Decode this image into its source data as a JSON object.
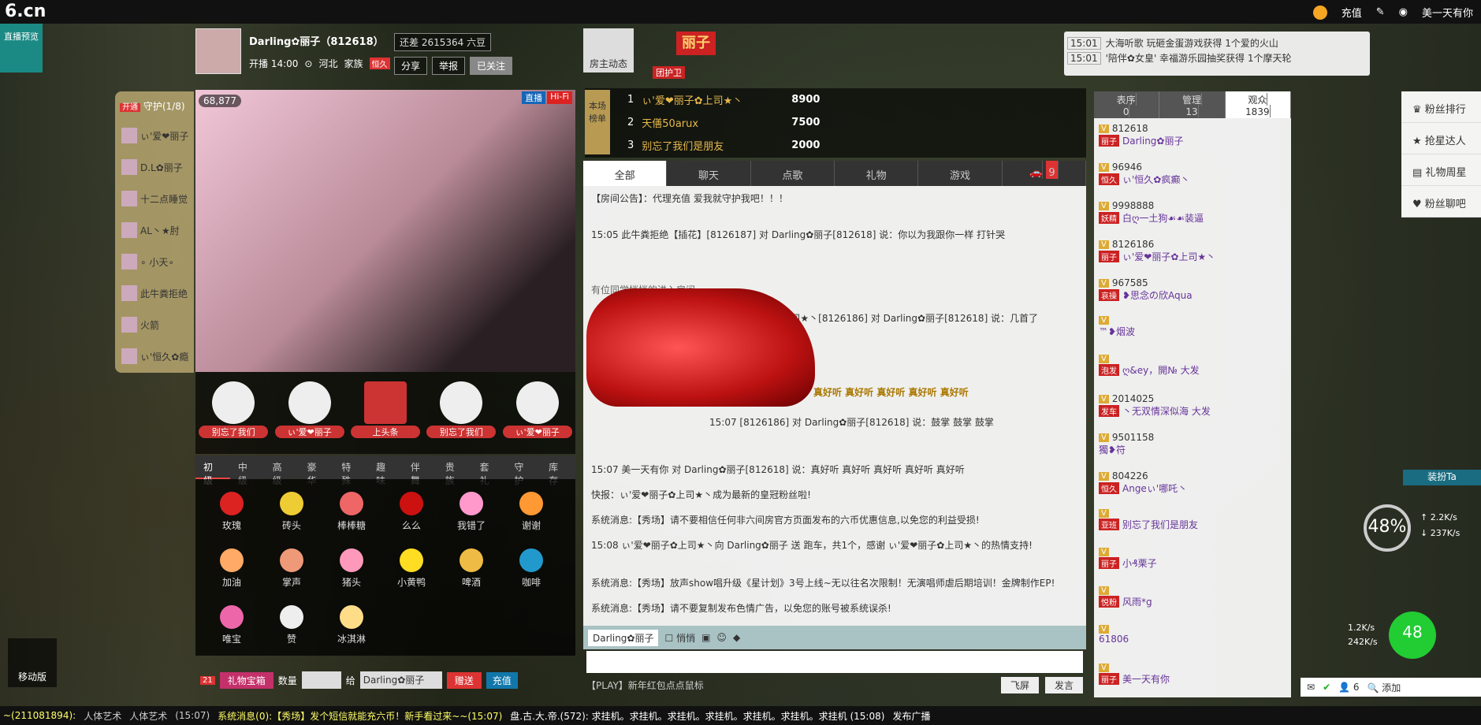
{
  "topbar": {
    "logo": "6.cn",
    "recharge": "充值",
    "username": "美一天有你"
  },
  "live_preview": "直播预览",
  "host": {
    "name": "Darling✿丽子（812618）",
    "start": "开播 14:00",
    "region": "河北",
    "family_label": "家族",
    "family": "恒久",
    "beans": "还差 2615364 六豆",
    "share": "分享",
    "report": "举报",
    "followed": "已关注"
  },
  "home_dynamic": "房主动态",
  "lizi_badge": "丽子",
  "guard_team": "团护卫",
  "notices": [
    {
      "time": "15:01",
      "text": "大海听歌 玩砸金蛋游戏获得 1个爱的火山"
    },
    {
      "time": "15:01",
      "text": "'陪伴✿女皇' 幸福游乐园抽奖获得 1个摩天轮"
    }
  ],
  "guards": {
    "open": "开通",
    "title": "守护(1/8)",
    "items": [
      "ぃ'爱❤丽子",
      "D.L✿丽子",
      "十二点睡觉",
      "AL丶★肘",
      "∘ 小天∘",
      "此牛粪拒绝",
      "火箭",
      "ぃ'恒久✿瘾"
    ]
  },
  "video": {
    "viewers": "68,877",
    "tag1": "直播",
    "tag2": "Hi-Fi"
  },
  "ads": [
    "别忘了我们",
    "ぃ'爱❤丽子",
    "上头条",
    "别忘了我们",
    "ぃ'爱❤丽子"
  ],
  "gift_tabs": [
    "初级",
    "中级",
    "高级",
    "豪华",
    "特殊",
    "趣味",
    "伴舞",
    "贵族",
    "套礼",
    "守护",
    "库存"
  ],
  "gifts": [
    "玫瑰",
    "砖头",
    "棒棒糖",
    "么么",
    "我错了",
    "谢谢",
    "加油",
    "掌声",
    "猪头",
    "小黄鸭",
    "啤酒",
    "咖啡",
    "唯宝",
    "赞",
    "冰淇淋"
  ],
  "send": {
    "chest": "礼物宝箱",
    "chest_count": "21",
    "qty_label": "数量",
    "give_label": "给",
    "target": "Darling✿丽子",
    "give_btn": "赠送",
    "recharge": "充值"
  },
  "rank": {
    "title": "本场榜单",
    "rows": [
      {
        "n": "1",
        "nm": "ぃ'爱❤丽子✿上司★丶",
        "v": "8900"
      },
      {
        "n": "2",
        "nm": "天僐50arux",
        "v": "7500"
      },
      {
        "n": "3",
        "nm": "别忘了我们是朋友",
        "v": "2000"
      }
    ]
  },
  "chat_tabs": [
    "全部",
    "聊天",
    "点歌",
    "礼物",
    "游戏",
    "9"
  ],
  "chat": [
    "【房间公告】：代理充值 爱我就守护我吧！！！",
    "15:05 此牛粪拒绝【插花】[8126187] 对 Darling✿丽子[812618] 说：你以为我跟你一样 打针哭",
    "有位同学悄悄的进入房间",
    "ぃ'爱❤丽子✿上司★丶[8126186] 对 Darling✿丽子[812618] 说：几首了",
    "：真好听 真好听 真好听 真好听 真好听",
    "15:07 [8126186] 对 Darling✿丽子[812618] 说：鼓掌 鼓掌 鼓掌",
    "15:07 美一天有你 对 Darling✿丽子[812618] 说：真好听 真好听 真好听 真好听 真好听",
    "快报：ぃ'爱❤丽子✿上司★丶成为最新的皇冠粉丝啦!",
    "系统消息:【秀场】请不要相信任何非六间房官方页面发布的六币优惠信息,以免您的利益受损!",
    "15:08 ぃ'爱❤丽子✿上司★丶向 Darling✿丽子 送 跑车，共1个，感谢 ぃ'爱❤丽子✿上司★丶的热情支持!",
    "系统消息:【秀场】放声show唱升级《星计划》3号上线~无以往名次限制！无演唱师虐后期培训！金牌制作EP!",
    "系统消息:【秀场】请不要复制发布色情广告，以免您的账号被系统误杀!"
  ],
  "input": {
    "to": "Darling✿丽子",
    "whisper": "悄悄",
    "play": "【PLAY】新年红包点点鼠标",
    "fly": "飞屏",
    "send": "发言"
  },
  "user_tabs": [
    {
      "l": "表序",
      "n": "0"
    },
    {
      "l": "管理",
      "n": "13"
    },
    {
      "l": "观众",
      "n": "1839"
    }
  ],
  "users": [
    {
      "id": "812618",
      "nm": "Darling✿丽子"
    },
    {
      "id": "96946",
      "nm": "ぃ'恒久✿疯癫㇔"
    },
    {
      "id": "9998888",
      "nm": "白ღ一土狗☙☙装逼"
    },
    {
      "id": "8126186",
      "nm": "ぃ'爱❤丽子✿上司★丶"
    },
    {
      "id": "967585",
      "nm": "❥思念の欣Aqua"
    },
    {
      "id": "",
      "nm": "™❥烟波"
    },
    {
      "id": "",
      "nm": "ღ&ey，開№ 大发"
    },
    {
      "id": "2014025",
      "nm": "丶无双情深似海 大发"
    },
    {
      "id": "9501158",
      "nm": "獨❥符"
    },
    {
      "id": "804226",
      "nm": "Angeぃ'哪吒㇔"
    },
    {
      "id": "",
      "nm": "别忘了我们是朋友"
    },
    {
      "id": "",
      "nm": "小₰栗子"
    },
    {
      "id": "",
      "nm": "风雨*g"
    },
    {
      "id": "",
      "nm": "61806"
    },
    {
      "id": "",
      "nm": "美一天有你"
    }
  ],
  "right_menu": [
    "粉丝排行",
    "抢星达人",
    "礼物周星",
    "粉丝聊吧"
  ],
  "dress": "装扮Ta",
  "speed": {
    "pct": "48",
    "up": "2.2",
    "down": "237",
    "pct2": "48",
    "up2": "1.2K/s",
    "down2": "242K/s"
  },
  "mobile": "移动版",
  "status": {
    "count": "6",
    "add": "添加"
  },
  "footer": {
    "left": "~(211081894):",
    "art1": "人体艺术",
    "art2": "人体艺术",
    "time1": "(15:07)",
    "sys": "系统消息(0):【秀场】发个短信就能充六币！新手看过来~~(15:07)",
    "right": "盘.古.大.帝.(572): 求挂机。求挂机。求挂机。求挂机。求挂机。求挂机。求挂机 (15:08)",
    "broadcast": "发布广播"
  },
  "colors": {
    "accent": "#cc2222",
    "teal": "#1c8a84"
  }
}
